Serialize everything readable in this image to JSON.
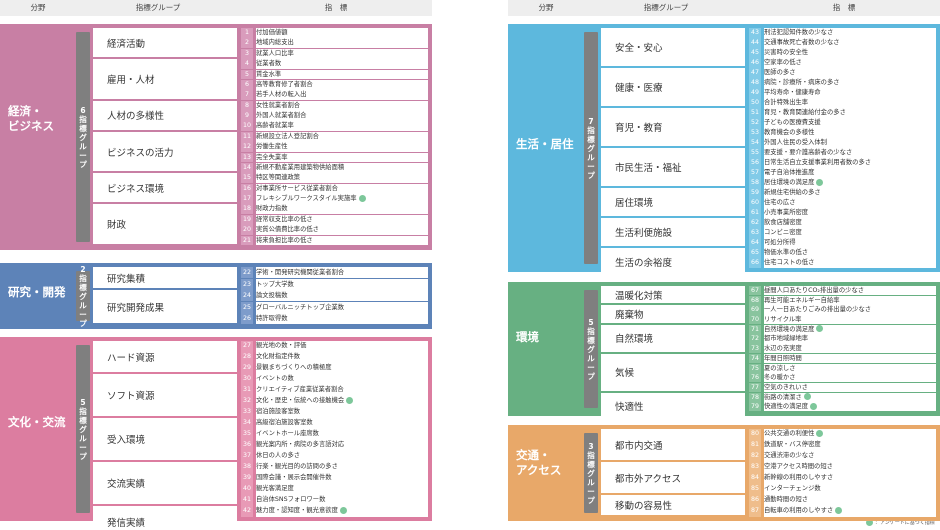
{
  "headers": {
    "bunya": "分野",
    "group": "指標グループ",
    "indicator": "指　標"
  },
  "survey_mark": "◎",
  "legend_text": "：アンケートに基づく指標",
  "sections": [
    {
      "key": "econ",
      "category": "経済・\nビジネス",
      "group_count": "6指標グループ",
      "color": "#c87fa4",
      "light": "#d99cbc",
      "groups": [
        {
          "name": "経済活動",
          "rows": 3
        },
        {
          "name": "雇用・人材",
          "rows": 4
        },
        {
          "name": "人材の多様性",
          "rows": 3
        },
        {
          "name": "ビジネスの活力",
          "rows": 4
        },
        {
          "name": "ビジネス環境",
          "rows": 3
        },
        {
          "name": "財政",
          "rows": 4
        }
      ],
      "indicators": [
        {
          "n": "1",
          "t": "付加価値額"
        },
        {
          "n": "2",
          "t": "地域内総支出"
        },
        {
          "n": "3",
          "t": "就業人口比率"
        },
        {
          "n": "4",
          "t": "従業者数"
        },
        {
          "n": "5",
          "t": "賃金水準"
        },
        {
          "n": "6",
          "t": "高等教育修了者割合"
        },
        {
          "n": "7",
          "t": "若手人材の転入出"
        },
        {
          "n": "8",
          "t": "女性就業者割合"
        },
        {
          "n": "9",
          "t": "外国人就業者割合"
        },
        {
          "n": "10",
          "t": "高齢者就業率"
        },
        {
          "n": "11",
          "t": "新規設立法人登記割合"
        },
        {
          "n": "12",
          "t": "労働生産性"
        },
        {
          "n": "13",
          "t": "完全失業率"
        },
        {
          "n": "14",
          "t": "新規不動産業用建築物供給面積"
        },
        {
          "n": "15",
          "t": "特区等関連政策"
        },
        {
          "n": "16",
          "t": "対事業所サービス従業者割合"
        },
        {
          "n": "17",
          "t": "フレキシブルワークスタイル実施率",
          "s": true
        },
        {
          "n": "18",
          "t": "財政力指数"
        },
        {
          "n": "19",
          "t": "経常収支比率の低さ"
        },
        {
          "n": "20",
          "t": "実質公債費比率の低さ"
        },
        {
          "n": "21",
          "t": "将来負担比率の低さ"
        }
      ]
    },
    {
      "key": "res",
      "category": "研究・開発",
      "group_count": "2指標グループ",
      "color": "#5d83b8",
      "light": "#7e9ccb",
      "groups": [
        {
          "name": "研究集積",
          "rows": 2
        },
        {
          "name": "研究開発成果",
          "rows": 3
        }
      ],
      "indicators": [
        {
          "n": "22",
          "t": "学術・開発研究機関従業者割合"
        },
        {
          "n": "23",
          "t": "トップ大学数"
        },
        {
          "n": "24",
          "t": "論文投稿数"
        },
        {
          "n": "25",
          "t": "グローバルニッチトップ企業数"
        },
        {
          "n": "26",
          "t": "特許取得数"
        }
      ]
    },
    {
      "key": "cul",
      "category": "文化・交流",
      "group_count": "5指標グループ",
      "color": "#dc7da0",
      "light": "#e89ab6",
      "groups": [
        {
          "name": "ハード資源",
          "rows": 3
        },
        {
          "name": "ソフト資源",
          "rows": 4
        },
        {
          "name": "受入環境",
          "rows": 4
        },
        {
          "name": "交流実績",
          "rows": 4
        },
        {
          "name": "発信実績",
          "rows": 3
        }
      ],
      "indicators": [
        {
          "n": "27",
          "t": "観光地の数・評価"
        },
        {
          "n": "28",
          "t": "文化財指定件数"
        },
        {
          "n": "29",
          "t": "景観まちづくりへの積極度"
        },
        {
          "n": "30",
          "t": "イベントの数"
        },
        {
          "n": "31",
          "t": "クリエイティブ産業従業者割合"
        },
        {
          "n": "32",
          "t": "文化・歴史・伝統への接触機会",
          "s": true
        },
        {
          "n": "33",
          "t": "宿泊施設客室数"
        },
        {
          "n": "34",
          "t": "高級宿泊施設客室数"
        },
        {
          "n": "35",
          "t": "イベントホール座席数"
        },
        {
          "n": "36",
          "t": "観光案内所・病院の多言語対応"
        },
        {
          "n": "37",
          "t": "休日の人の多さ"
        },
        {
          "n": "38",
          "t": "行楽・観光目的の訪問の多さ"
        },
        {
          "n": "39",
          "t": "国際会議・展示会開催件数"
        },
        {
          "n": "40",
          "t": "観光客満足度"
        },
        {
          "n": "41",
          "t": "自治体SNSフォロワー数"
        },
        {
          "n": "42",
          "t": "魅力度・認知度・観光意欲度",
          "s": true
        }
      ]
    },
    {
      "key": "life",
      "category": "生活・居住",
      "group_count": "7指標グループ",
      "color": "#5db8dd",
      "light": "#82cbe8",
      "groups": [
        {
          "name": "安全・安心",
          "rows": 4
        },
        {
          "name": "健康・医療",
          "rows": 4
        },
        {
          "name": "育児・教育",
          "rows": 4
        },
        {
          "name": "市民生活・福祉",
          "rows": 4
        },
        {
          "name": "居住環境",
          "rows": 3
        },
        {
          "name": "生活利便施設",
          "rows": 3
        },
        {
          "name": "生活の余裕度",
          "rows": 3
        }
      ],
      "indicators": [
        {
          "n": "43",
          "t": "刑法犯認知件数の少なさ"
        },
        {
          "n": "44",
          "t": "交通事故死亡者数の少なさ"
        },
        {
          "n": "45",
          "t": "災害時の安全性"
        },
        {
          "n": "46",
          "t": "空家率の低さ"
        },
        {
          "n": "47",
          "t": "医師の多さ"
        },
        {
          "n": "48",
          "t": "病院・診療所・病床の多さ"
        },
        {
          "n": "49",
          "t": "平均寿命・健康寿命"
        },
        {
          "n": "50",
          "t": "合計特殊出生率"
        },
        {
          "n": "51",
          "t": "育児・教育関連給付金の多さ"
        },
        {
          "n": "52",
          "t": "子どもの医療費支援"
        },
        {
          "n": "53",
          "t": "教育機会の多様性"
        },
        {
          "n": "54",
          "t": "外国人住民の受入体制"
        },
        {
          "n": "55",
          "t": "要支援・要介護高齢者の少なさ"
        },
        {
          "n": "56",
          "t": "日常生活自立支援事業利用者数の多さ"
        },
        {
          "n": "57",
          "t": "電子自治体推進度"
        },
        {
          "n": "58",
          "t": "居住環境の満足度",
          "s": true
        },
        {
          "n": "59",
          "t": "新規住宅供給の多さ"
        },
        {
          "n": "60",
          "t": "住宅の広さ"
        },
        {
          "n": "61",
          "t": "小売事業所密度"
        },
        {
          "n": "62",
          "t": "飲食店舗密度"
        },
        {
          "n": "63",
          "t": "コンビニ密度"
        },
        {
          "n": "64",
          "t": "可処分所得"
        },
        {
          "n": "65",
          "t": "物価水準の低さ"
        },
        {
          "n": "66",
          "t": "住宅コストの低さ"
        }
      ]
    },
    {
      "key": "env",
      "category": "環境",
      "group_count": "5指標グループ",
      "color": "#67b082",
      "light": "#89c49e",
      "groups": [
        {
          "name": "温暖化対策",
          "rows": 2
        },
        {
          "name": "廃棄物",
          "rows": 2
        },
        {
          "name": "自然環境",
          "rows": 3
        },
        {
          "name": "気候",
          "rows": 4
        },
        {
          "name": "快適性",
          "rows": 3
        }
      ],
      "indicators": [
        {
          "n": "67",
          "t": "昼間人口あたりCO₂排出量の少なさ"
        },
        {
          "n": "68",
          "t": "再生可能エネルギー自給率"
        },
        {
          "n": "69",
          "t": "一人一日あたりごみの排出量の少なさ"
        },
        {
          "n": "70",
          "t": "リサイクル率"
        },
        {
          "n": "71",
          "t": "自然環境の満足度",
          "s": true
        },
        {
          "n": "72",
          "t": "都市地域緑地率"
        },
        {
          "n": "73",
          "t": "水辺の充実度"
        },
        {
          "n": "74",
          "t": "年間日照時間"
        },
        {
          "n": "75",
          "t": "夏の涼しさ"
        },
        {
          "n": "76",
          "t": "冬の暖かさ"
        },
        {
          "n": "77",
          "t": "空気のきれいさ"
        },
        {
          "n": "78",
          "t": "街路の清潔さ",
          "s": true
        },
        {
          "n": "79",
          "t": "快適性の満足度",
          "s": true
        }
      ]
    },
    {
      "key": "trans",
      "category": "交通・\nアクセス",
      "group_count": "3指標グループ",
      "color": "#e8a869",
      "light": "#efbd8b",
      "groups": [
        {
          "name": "都市内交通",
          "rows": 3
        },
        {
          "name": "都市外アクセス",
          "rows": 3
        },
        {
          "name": "移動の容易性",
          "rows": 2
        }
      ],
      "indicators": [
        {
          "n": "80",
          "t": "公共交通の利便性",
          "s": true
        },
        {
          "n": "81",
          "t": "鉄道駅・バス停密度"
        },
        {
          "n": "82",
          "t": "交通渋滞の少なさ"
        },
        {
          "n": "83",
          "t": "空港アクセス時間の短さ"
        },
        {
          "n": "84",
          "t": "新幹線の利用のしやすさ"
        },
        {
          "n": "85",
          "t": "インターチェンジ数"
        },
        {
          "n": "86",
          "t": "通勤時間の短さ"
        },
        {
          "n": "87",
          "t": "自転車の利用のしやすさ",
          "s": true
        }
      ]
    }
  ]
}
